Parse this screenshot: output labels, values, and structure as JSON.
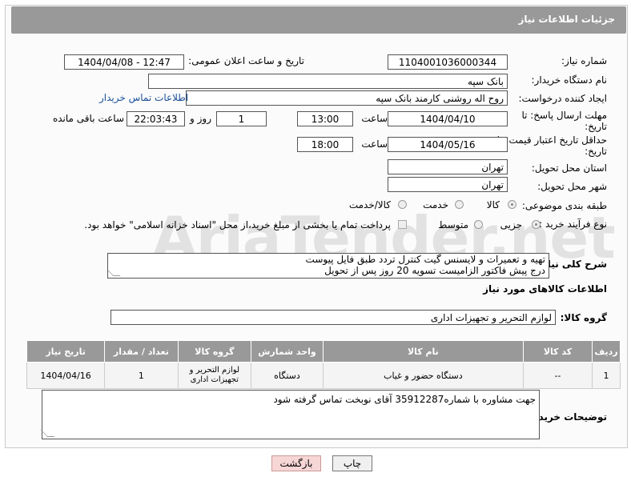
{
  "header": {
    "title": "جزئیات اطلاعات نیاز"
  },
  "fields": {
    "need_number_label": "شماره نیاز:",
    "need_number": "1104001036000344",
    "announce_label": "تاریخ و ساعت اعلان عمومی:",
    "announce_value": "1404/04/08 - 12:47",
    "buyer_org_label": "نام دستگاه خریدار:",
    "buyer_org": "بانک سپه",
    "creator_label": "ایجاد کننده درخواست:",
    "creator": "روح اله روشنی کارمند بانک سپه",
    "buyer_contact_link": "اطلاعات تماس خریدار",
    "deadline_label": "مهلت ارسال پاسخ: تا تاریخ:",
    "deadline_date": "1404/04/10",
    "time_label": "ساعت",
    "deadline_time": "13:00",
    "days_value": "1",
    "days_label": "روز و",
    "remaining_time": "22:03:43",
    "remaining_label": "ساعت باقی مانده",
    "min_price_label": "حداقل تاریخ اعتبار قیمت: تا تاریخ:",
    "min_price_date": "1404/05/16",
    "min_price_time": "18:00",
    "province_label": "استان محل تحویل:",
    "province": "تهران",
    "city_label": "شهر محل تحویل:",
    "city": "تهران",
    "category_label": "طبقه بندی موضوعی:",
    "category_options": [
      "کالا",
      "خدمت",
      "کالا/خدمت"
    ],
    "process_label": "نوع فرآیند خرید :",
    "process_options": [
      "جزیی",
      "متوسط"
    ],
    "process_note": "پرداخت تمام یا بخشی از مبلغ خرید،از محل \"اسناد خزانه اسلامی\" خواهد بود."
  },
  "description": {
    "label": "شرح کلی نیاز:",
    "line1": "تهیه و تعمیرات و لایسنس گیت کنترل تردد طبق فایل پیوست",
    "line2": "درج پیش فاکتور الزامیست تسویه 20 روز پس از تحویل"
  },
  "goods_info_title": "اطلاعات کالاهای مورد نیاز",
  "goods_group": {
    "label": "گروه کالا:",
    "value": "لوازم التحریر و تجهیزات اداری"
  },
  "table": {
    "headers": [
      "ردیف",
      "کد کالا",
      "نام کالا",
      "واحد شمارش",
      "گروه کالا",
      "تعداد / مقدار",
      "تاریخ نیاز"
    ],
    "rows": [
      [
        "1",
        "--",
        "دستگاه حضور و غیاب",
        "دستگاه",
        "لوازم التحریر و تجهیزات اداری",
        "1",
        "1404/04/16"
      ]
    ]
  },
  "buyer_notes": {
    "label": "توضیحات خریدار:",
    "text": "جهت مشاوره با شماره35912287 آقای نوبخت تماس گرفته شود"
  },
  "buttons": {
    "print": "چاپ",
    "back": "بازگشت"
  },
  "watermark": "AriaTender.net",
  "colors": {
    "header_bg": "#999999",
    "link": "#1a4f9a",
    "back_btn_bg": "#f7d6d6"
  }
}
